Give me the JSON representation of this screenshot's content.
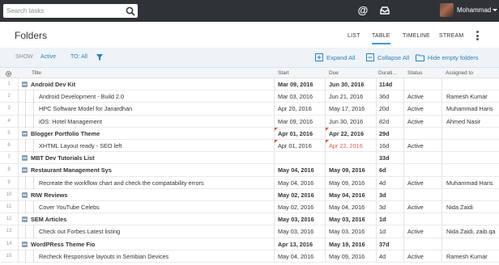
{
  "topbar": {
    "search_placeholder": "Search tasks",
    "user_name": "Mohammad",
    "icons": [
      "search-icon",
      "at-icon",
      "inbox-icon",
      "avatar",
      "chevron-down-icon"
    ]
  },
  "header": {
    "title": "Folders",
    "tabs": [
      "LIST",
      "TABLE",
      "TIMELINE",
      "STREAM"
    ],
    "active_tab": "TABLE"
  },
  "filterbar": {
    "show_label": "SHOW",
    "show_value": "Active",
    "to_label": "TO: All",
    "expand_all": "Expand All",
    "collapse_all": "Collapse All",
    "hide_empty": "Hide empty folders"
  },
  "colors": {
    "accent": "#3b9bd4",
    "topbar": "#2f3338",
    "overdue": "#e05a4f"
  },
  "table": {
    "columns": [
      "Title",
      "Start",
      "Due",
      "Durati...",
      "Status",
      "Assigned to"
    ],
    "rows": [
      {
        "num": "1",
        "title": "Android Dev Kit",
        "folder": true,
        "start": "Mar 09, 2016",
        "due": "Jun 30, 2016",
        "duration": "114d",
        "status": "",
        "assigned": ""
      },
      {
        "num": "2",
        "title": "Android Development - Build 2.0",
        "folder": false,
        "start": "Mar 03, 2016",
        "due": "Jun 21, 2016",
        "duration": "36d",
        "status": "Active",
        "assigned": "Ramesh Kumar"
      },
      {
        "num": "3",
        "title": "HPC Software Model for Janardhan",
        "folder": false,
        "start": "Apr 20, 2016",
        "due": "May 17, 2016",
        "duration": "20d",
        "status": "Active",
        "assigned": "Muhammad Haris"
      },
      {
        "num": "4",
        "title": "iOS: Hotel Management",
        "folder": false,
        "start": "Mar 09, 2016",
        "due": "Jun 30, 2016",
        "duration": "82d",
        "status": "Active",
        "assigned": "Ahmed Nasir"
      },
      {
        "num": "5",
        "title": "Blogger Portfolio Theme",
        "folder": true,
        "start": "Apr 01, 2016",
        "due": "Apr 22, 2016",
        "duration": "29d",
        "status": "",
        "assigned": ""
      },
      {
        "num": "6",
        "title": "XHTML Layout ready - SEO left",
        "folder": false,
        "start": "Apr 01, 2016",
        "due": "Apr 22, 2016",
        "duration": "16d",
        "status": "Active",
        "assigned": ""
      },
      {
        "num": "7",
        "title": "MBT Dev Tutorials List",
        "folder": true,
        "start": "",
        "due": "",
        "duration": "33d",
        "status": "",
        "assigned": ""
      },
      {
        "num": "8",
        "title": "Restaurant Management Sys",
        "folder": true,
        "start": "May 04, 2016",
        "due": "May 09, 2016",
        "duration": "6d",
        "status": "",
        "assigned": ""
      },
      {
        "num": "9",
        "title": "Recreate the workflow chart and check the compatability errors",
        "folder": false,
        "start": "May 04, 2016",
        "due": "May 09, 2016",
        "duration": "4d",
        "status": "Active",
        "assigned": "Muhammad Haris"
      },
      {
        "num": "10",
        "title": "RIW Reviews",
        "folder": true,
        "start": "May 02, 2016",
        "due": "May 04, 2016",
        "duration": "3d",
        "status": "",
        "assigned": ""
      },
      {
        "num": "11",
        "title": "Cover YouTube Celebs",
        "folder": false,
        "start": "May 02, 2016",
        "due": "May 04, 2016",
        "duration": "3d",
        "status": "Active",
        "assigned": "Nida Zaidi"
      },
      {
        "num": "12",
        "title": "SEM Articles",
        "folder": true,
        "start": "May 03, 2016",
        "due": "May 03, 2016",
        "duration": "1d",
        "status": "",
        "assigned": ""
      },
      {
        "num": "13",
        "title": "Check out Forbes Latest listing",
        "folder": false,
        "start": "May 03, 2016",
        "due": "May 03, 2016",
        "duration": "1d",
        "status": "Active",
        "assigned": "Nida Zaidi, zaib.qa"
      },
      {
        "num": "14",
        "title": "WordPRess Theme Fio",
        "folder": true,
        "start": "Apr 13, 2016",
        "due": "May 19, 2016",
        "duration": "37d",
        "status": "",
        "assigned": ""
      },
      {
        "num": "15",
        "title": "Recheck Responsive layouts in Sembian Devices",
        "folder": false,
        "start": "May 04, 2016",
        "due": "May 09, 2016",
        "duration": "4d",
        "status": "Active",
        "assigned": "Ramesh Kumar"
      }
    ]
  }
}
